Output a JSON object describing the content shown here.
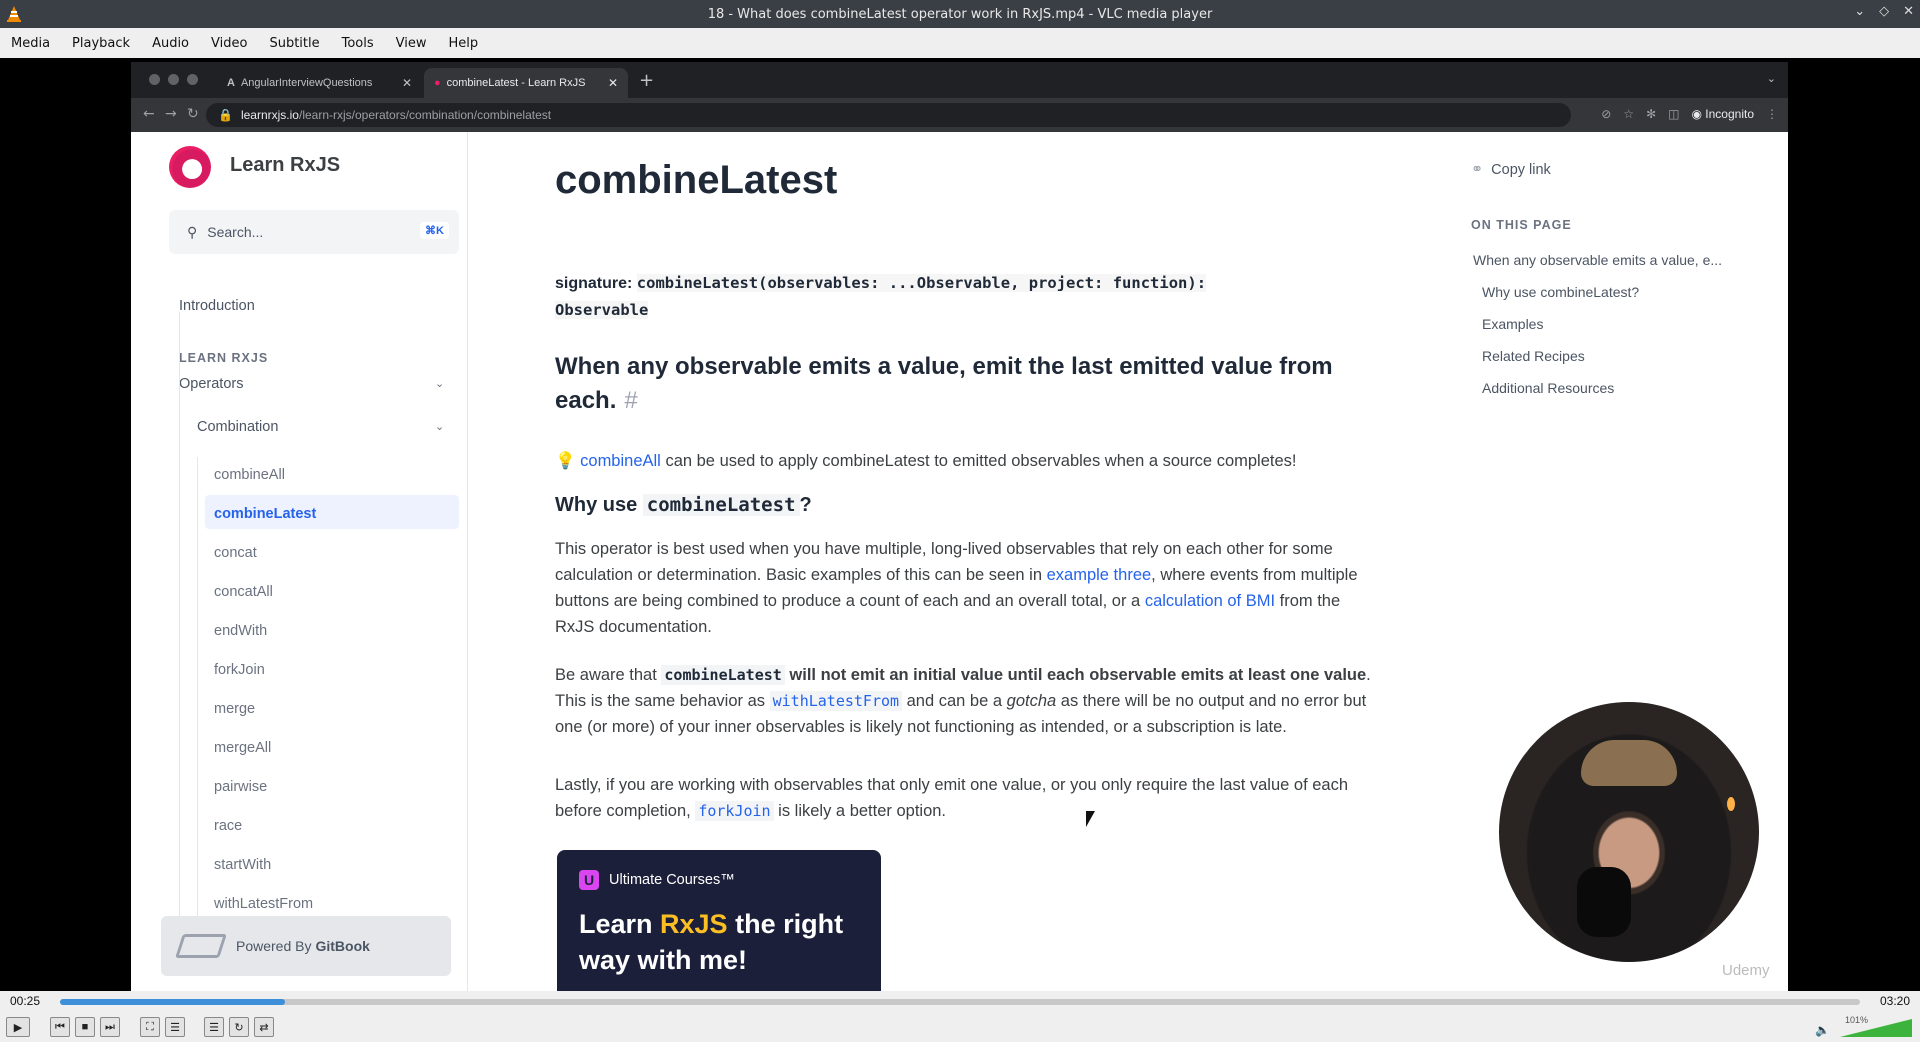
{
  "window": {
    "title": "18 - What does combineLatest operator work in RxJS.mp4 - VLC media player",
    "icon": "vlc-cone-icon"
  },
  "menu": [
    "Media",
    "Playback",
    "Audio",
    "Video",
    "Subtitle",
    "Tools",
    "View",
    "Help"
  ],
  "browser": {
    "tabs": [
      {
        "label": "AngularInterviewQuestions",
        "icon": "angular-icon"
      },
      {
        "label": "combineLatest - Learn RxJS",
        "icon": "rxjs-icon"
      }
    ],
    "url_domain": "learnrxjs.io",
    "url_path": "/learn-rxjs/operators/combination/combinelatest",
    "profile": "Incognito"
  },
  "sidebar": {
    "brand": "Learn RxJS",
    "search_placeholder": "Search...",
    "search_shortcut": "⌘K",
    "introduction": "Introduction",
    "section": "LEARN RXJS",
    "operators": "Operators",
    "combination": "Combination",
    "operators_list": [
      "combineAll",
      "combineLatest",
      "concat",
      "concatAll",
      "endWith",
      "forkJoin",
      "merge",
      "mergeAll",
      "pairwise",
      "race",
      "startWith",
      "withLatestFrom"
    ],
    "active": "combineLatest",
    "powered_prefix": "Powered By",
    "powered_brand": "GitBook"
  },
  "article": {
    "title": "combineLatest",
    "signature_label": "signature:",
    "signature_line1": "combineLatest(observables: ...Observable, project: function):",
    "signature_line2": "Observable",
    "heading": "When any observable emits a value, emit the last emitted value from each.",
    "heading_anchor": "#",
    "tip_icon": "💡",
    "tip_link": "combineAll",
    "tip_text": " can be used to apply combineLatest to emitted observables when a source completes!",
    "why_prefix": "Why use ",
    "why_code": "combineLatest",
    "why_suffix": "?",
    "p1_a": "This operator is best used when you have multiple, long-lived observables that rely on each other for some calculation or determination. Basic examples of this can be seen in ",
    "p1_link1": "example three",
    "p1_b": ", where events from multiple buttons are being combined to produce a count of each and an overall total, or a ",
    "p1_link2": "calculation of BMI",
    "p1_c": " from the RxJS documentation.",
    "p2_a": "Be aware that ",
    "p2_code": "combineLatest",
    "p2_bold": " will not emit an initial value until each observable emits at least one value",
    "p2_b": ". This is the same behavior as ",
    "p2_link": "withLatestFrom",
    "p2_c": " and can be a ",
    "p2_em": "gotcha",
    "p2_d": " as there will be no output and no error but one (or more) of your inner observables is likely not functioning as intended, or a subscription is late.",
    "p3_a": "Lastly, if you are working with observables that only emit one value, or you only require the last value of each before completion, ",
    "p3_link": "forkJoin",
    "p3_b": " is likely a better option.",
    "promo_brand": "Ultimate Courses™",
    "promo_line_a": "Learn ",
    "promo_highlight": "RxJS",
    "promo_line_b": " the right way with me!"
  },
  "toc": {
    "copy_link": "Copy link",
    "heading": "ON THIS PAGE",
    "items": [
      "When any observable emits a value, e...",
      "Why use combineLatest?",
      "Examples",
      "Related Recipes",
      "Additional Resources"
    ]
  },
  "overlay": {
    "watermark": "Udemy"
  },
  "player": {
    "time_current": "00:25",
    "time_total": "03:20",
    "progress": 0.125,
    "volume_label": "101%",
    "volume": 1.01
  }
}
